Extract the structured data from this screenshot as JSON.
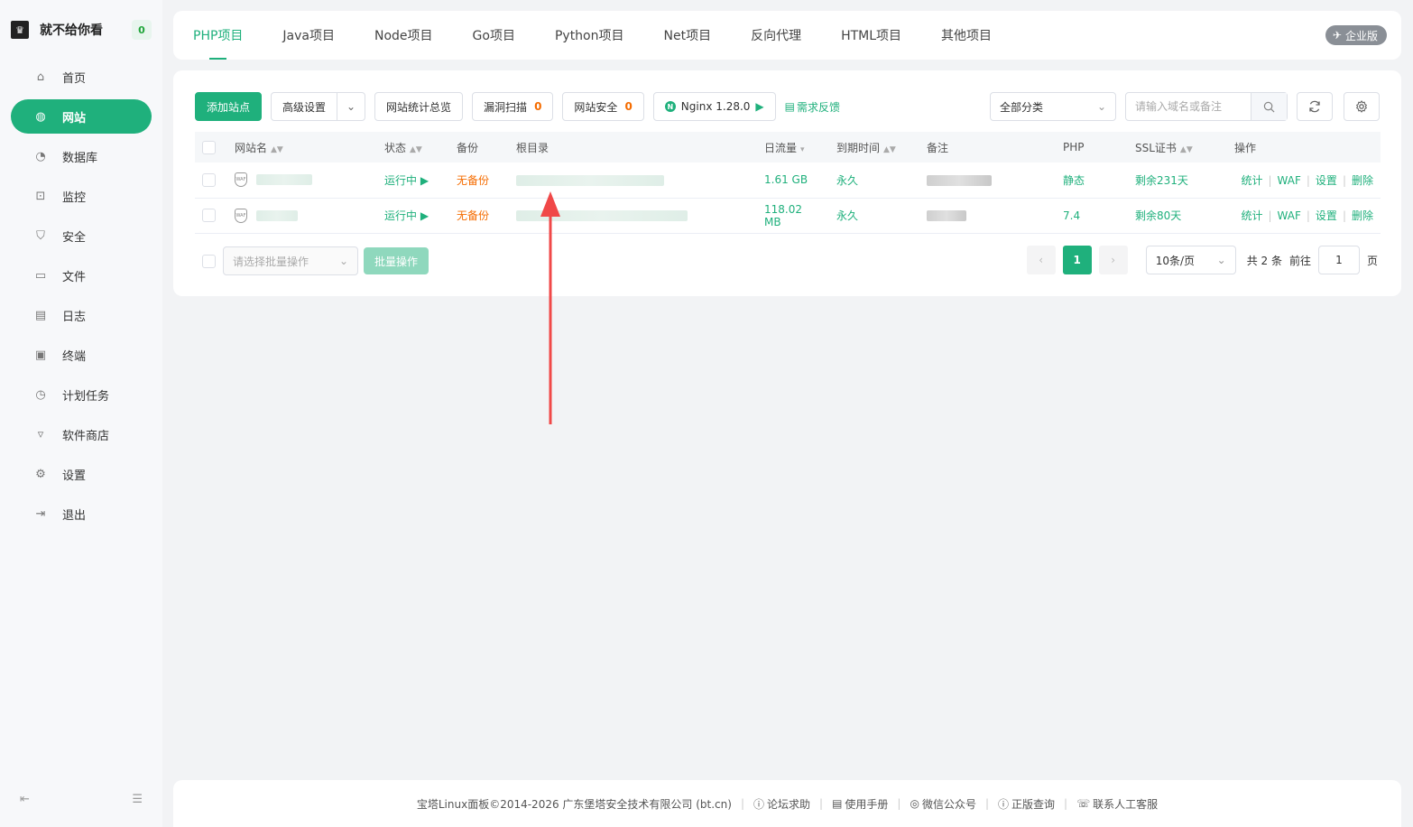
{
  "user": {
    "avatar_glyph": "♛",
    "name": "就不给你看",
    "badge": "0"
  },
  "nav": [
    {
      "label": "首页",
      "icon": "home-icon",
      "glyph": "⌂",
      "active": false
    },
    {
      "label": "网站",
      "icon": "globe-icon",
      "glyph": "◍",
      "active": true
    },
    {
      "label": "数据库",
      "icon": "database-icon",
      "glyph": "◔",
      "active": false
    },
    {
      "label": "监控",
      "icon": "monitor-icon",
      "glyph": "⊡",
      "active": false
    },
    {
      "label": "安全",
      "icon": "shield-icon",
      "glyph": "⛉",
      "active": false
    },
    {
      "label": "文件",
      "icon": "folder-icon",
      "glyph": "▭",
      "active": false
    },
    {
      "label": "日志",
      "icon": "log-icon",
      "glyph": "▤",
      "active": false
    },
    {
      "label": "终端",
      "icon": "terminal-icon",
      "glyph": "▣",
      "active": false
    },
    {
      "label": "计划任务",
      "icon": "clock-icon",
      "glyph": "◷",
      "active": false
    },
    {
      "label": "软件商店",
      "icon": "store-icon",
      "glyph": "▿",
      "active": false
    },
    {
      "label": "设置",
      "icon": "settings-icon",
      "glyph": "⚙",
      "active": false
    },
    {
      "label": "退出",
      "icon": "logout-icon",
      "glyph": "⇥",
      "active": false
    }
  ],
  "sidebar_bottom": {
    "left_glyph": "⇤",
    "right_glyph": "☰"
  },
  "tabs": [
    "PHP项目",
    "Java项目",
    "Node项目",
    "Go项目",
    "Python项目",
    "Net项目",
    "反向代理",
    "HTML项目",
    "其他项目"
  ],
  "active_tab": 0,
  "enterprise": {
    "label": "企业版",
    "glyph": "✈"
  },
  "toolbar": {
    "add_site": "添加站点",
    "advanced": "高级设置",
    "stats_overview": "网站统计总览",
    "vuln_scan": "漏洞扫描",
    "vuln_count": "0",
    "site_security": "网站安全",
    "security_count": "0",
    "nginx": "Nginx 1.28.0",
    "nginx_glyph": "N",
    "feedback": "需求反馈",
    "category": "全部分类",
    "search_placeholder": "请输入域名或备注"
  },
  "columns": [
    "网站名",
    "状态",
    "备份",
    "根目录",
    "日流量",
    "到期时间",
    "备注",
    "PHP",
    "SSL证书",
    "操作"
  ],
  "rows": [
    {
      "status": "运行中",
      "backup": "无备份",
      "traffic": "1.61 GB",
      "expire": "永久",
      "php": "静态",
      "ssl": "剩余231天"
    },
    {
      "status": "运行中",
      "backup": "无备份",
      "traffic": "118.02 MB",
      "expire": "永久",
      "php": "7.4",
      "ssl": "剩余80天"
    }
  ],
  "ops": [
    "统计",
    "WAF",
    "设置",
    "删除"
  ],
  "waf_label": "WAF",
  "batch": {
    "placeholder": "请选择批量操作",
    "button": "批量操作"
  },
  "pager": {
    "current": "1",
    "per_page": "10条/页",
    "total": "共 2 条",
    "goto_label": "前往",
    "goto_value": "1",
    "page_suffix": "页"
  },
  "footer": {
    "copyright": "宝塔Linux面板©2014-2026 广东堡塔安全技术有限公司 (bt.cn)",
    "links": [
      "论坛求助",
      "使用手册",
      "微信公众号",
      "正版查询",
      "联系人工客服"
    ]
  },
  "colors": {
    "accent": "#1fb07c",
    "warning": "#f56c00",
    "annotation_arrow": "#f04848"
  }
}
